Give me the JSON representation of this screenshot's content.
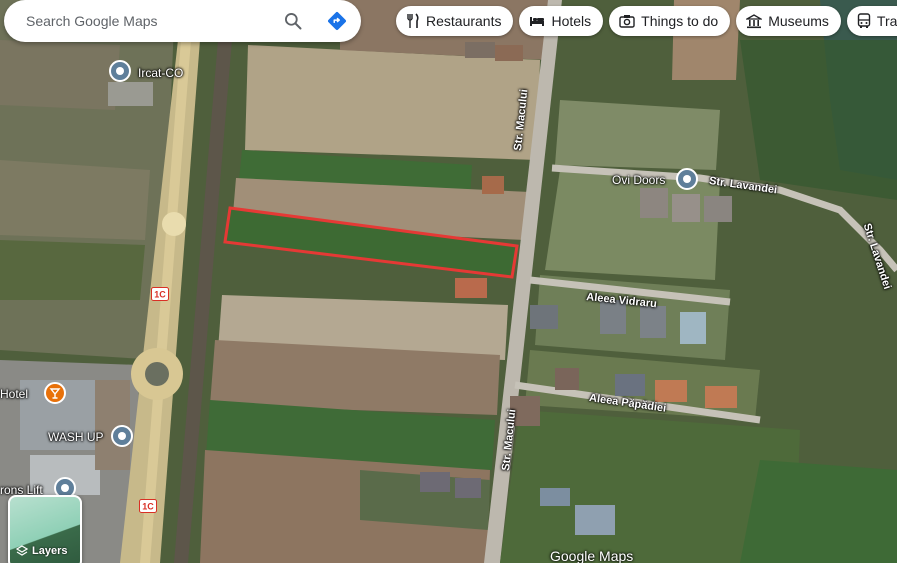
{
  "search": {
    "placeholder": "Search Google Maps"
  },
  "chips": [
    {
      "label": "Restaurants",
      "icon": "fork-knife-icon"
    },
    {
      "label": "Hotels",
      "icon": "bed-icon"
    },
    {
      "label": "Things to do",
      "icon": "camera-icon"
    },
    {
      "label": "Museums",
      "icon": "museum-icon"
    },
    {
      "label": "Trans",
      "icon": "bus-icon"
    }
  ],
  "places": {
    "ircat": "Ircat-CO",
    "ovi_doors": "Ovi Doors",
    "hotel": "Hotel",
    "wash_up": "WASH UP",
    "rons_lift": "rons Lift"
  },
  "streets": {
    "macului_top": "Str. Macului",
    "macului_bottom": "Str. Macului",
    "lavandei_1": "Str. Lavandei",
    "lavandei_2": "Str. Lavandei",
    "vidraru": "Aleea Vidraru",
    "papadiei": "Aleea Păpădiei"
  },
  "road_shields": [
    "1C",
    "1C"
  ],
  "layers": {
    "label": "Layers"
  },
  "brand": "Google Maps",
  "colors": {
    "selection": "#e53935",
    "pin": "#5f7f9a",
    "hotel_pin": "#e8710a"
  }
}
